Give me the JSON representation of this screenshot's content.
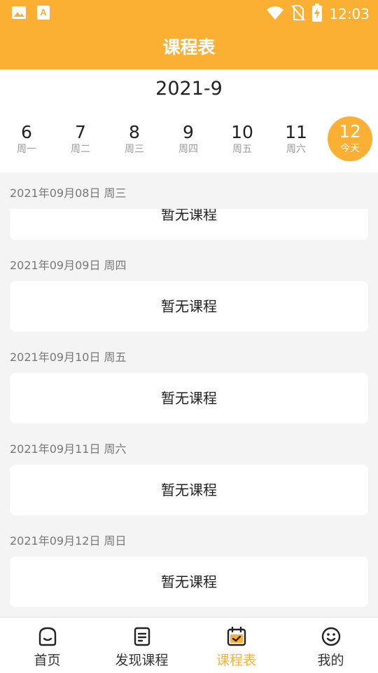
{
  "status_bar": {
    "time": "12:03",
    "icons": [
      "gallery-icon",
      "a-icon",
      "wifi-icon",
      "no-sim-icon",
      "battery-charging-icon"
    ]
  },
  "header": {
    "title": "课程表"
  },
  "calendar": {
    "month": "2021-9",
    "days": [
      {
        "num": "6",
        "weekday": "周一"
      },
      {
        "num": "7",
        "weekday": "周二"
      },
      {
        "num": "8",
        "weekday": "周三"
      },
      {
        "num": "9",
        "weekday": "周四"
      },
      {
        "num": "10",
        "weekday": "周五"
      },
      {
        "num": "11",
        "weekday": "周六"
      },
      {
        "num": "12",
        "weekday": "今天",
        "today": true
      }
    ]
  },
  "schedule": [
    {
      "date": "2021年09月08日 周三",
      "empty_text": "暂无课程"
    },
    {
      "date": "2021年09月09日 周四",
      "empty_text": "暂无课程"
    },
    {
      "date": "2021年09月10日 周五",
      "empty_text": "暂无课程"
    },
    {
      "date": "2021年09月11日 周六",
      "empty_text": "暂无课程"
    },
    {
      "date": "2021年09月12日 周日",
      "empty_text": "暂无课程"
    }
  ],
  "bottom_nav": {
    "items": [
      {
        "label": "首页",
        "icon": "home-face-icon"
      },
      {
        "label": "发现课程",
        "icon": "document-icon"
      },
      {
        "label": "课程表",
        "icon": "calendar-check-icon",
        "active": true
      },
      {
        "label": "我的",
        "icon": "smiley-icon"
      }
    ]
  },
  "colors": {
    "accent": "#fbb034",
    "background": "#f4f4f4"
  }
}
